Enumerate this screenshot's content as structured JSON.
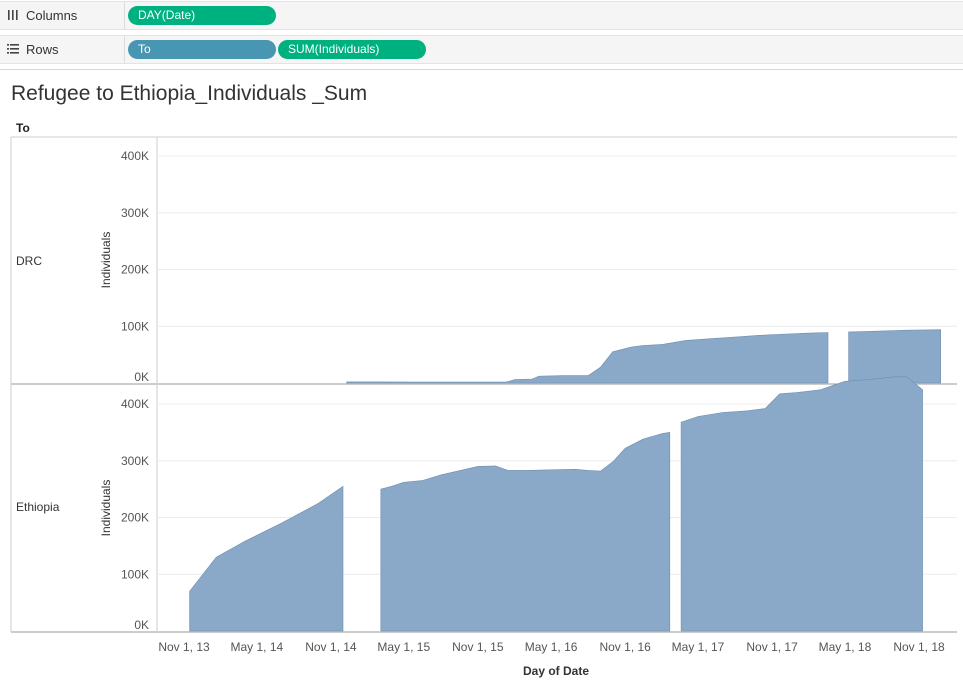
{
  "columns_shelf": {
    "label": "Columns",
    "pills": [
      {
        "text": "DAY(Date)",
        "color": "#00b180"
      }
    ]
  },
  "rows_shelf": {
    "label": "Rows",
    "pills": [
      {
        "text": "To",
        "color": "#4996b2"
      },
      {
        "text": "SUM(Individuals)",
        "color": "#00b180"
      }
    ]
  },
  "colors": {
    "area": "#8aa8c7",
    "area_stroke": "#6f8fb2",
    "grid": "#ececec",
    "axis": "#cfcfcf"
  },
  "chart_data": {
    "type": "area",
    "title": "Refugee to Ethiopia_Individuals _Sum",
    "row_dimension": "To",
    "xlabel": "Day of Date",
    "ylabel": "Individuals",
    "x_ticks": [
      "Nov 1, 13",
      "May 1, 14",
      "Nov 1, 14",
      "May 1, 15",
      "Nov 1, 15",
      "May 1, 16",
      "Nov 1, 16",
      "May 1, 17",
      "Nov 1, 17",
      "May 1, 18",
      "Nov 1, 18"
    ],
    "y_ticks": [
      "0K",
      "100K",
      "200K",
      "300K",
      "400K"
    ],
    "ylim": [
      0,
      460000
    ],
    "grid": true,
    "panes": [
      {
        "name": "DRC",
        "segments": [
          [
            [
              "2014-12-10",
              2000
            ],
            [
              "2015-03-01",
              2000
            ],
            [
              "2015-06-01",
              1800
            ],
            [
              "2015-09-01",
              1500
            ],
            [
              "2015-12-01",
              1500
            ],
            [
              "2016-01-10",
              1500
            ],
            [
              "2016-02-01",
              6000
            ],
            [
              "2016-03-15",
              7000
            ],
            [
              "2016-04-01",
              12000
            ],
            [
              "2016-06-01",
              13000
            ],
            [
              "2016-08-01",
              13000
            ],
            [
              "2016-09-01",
              28000
            ],
            [
              "2016-10-01",
              55000
            ],
            [
              "2016-11-15",
              63000
            ],
            [
              "2016-12-15",
              66000
            ],
            [
              "2017-02-01",
              68000
            ],
            [
              "2017-04-01",
              75000
            ],
            [
              "2017-06-01",
              78000
            ],
            [
              "2017-08-01",
              81000
            ],
            [
              "2017-10-01",
              84000
            ],
            [
              "2017-12-01",
              86000
            ],
            [
              "2018-02-01",
              88000
            ],
            [
              "2018-03-20",
              89000
            ]
          ],
          [
            [
              "2018-05-10",
              90000
            ],
            [
              "2018-07-01",
              91000
            ],
            [
              "2018-10-01",
              93000
            ],
            [
              "2018-12-25",
              94000
            ]
          ]
        ]
      },
      {
        "name": "Ethiopia",
        "segments": [
          [
            [
              "2013-11-15",
              70000
            ],
            [
              "2014-01-20",
              130000
            ],
            [
              "2014-04-01",
              158000
            ],
            [
              "2014-07-01",
              190000
            ],
            [
              "2014-10-01",
              225000
            ],
            [
              "2014-12-01",
              255000
            ]
          ],
          [
            [
              "2015-03-05",
              250000
            ],
            [
              "2015-04-01",
              255000
            ],
            [
              "2015-05-01",
              262000
            ],
            [
              "2015-06-15",
              265000
            ],
            [
              "2015-08-01",
              275000
            ],
            [
              "2015-09-01",
              280000
            ],
            [
              "2015-11-01",
              290000
            ],
            [
              "2015-12-15",
              291000
            ],
            [
              "2016-01-15",
              283000
            ],
            [
              "2016-03-01",
              283000
            ],
            [
              "2016-05-01",
              284000
            ],
            [
              "2016-07-01",
              285000
            ],
            [
              "2016-08-01",
              283000
            ],
            [
              "2016-09-01",
              282000
            ],
            [
              "2016-10-01",
              298000
            ],
            [
              "2016-11-01",
              322000
            ],
            [
              "2016-12-15",
              338000
            ],
            [
              "2017-02-01",
              348000
            ],
            [
              "2017-02-20",
              350000
            ]
          ],
          [
            [
              "2017-03-20",
              368000
            ],
            [
              "2017-05-01",
              378000
            ],
            [
              "2017-07-01",
              385000
            ],
            [
              "2017-09-01",
              388000
            ],
            [
              "2017-10-15",
              392000
            ],
            [
              "2017-11-20",
              418000
            ],
            [
              "2018-01-01",
              420000
            ],
            [
              "2018-03-01",
              425000
            ],
            [
              "2018-05-01",
              440000
            ],
            [
              "2018-07-01",
              443000
            ],
            [
              "2018-09-01",
              448000
            ],
            [
              "2018-10-01",
              448000
            ],
            [
              "2018-11-10",
              425000
            ]
          ]
        ]
      }
    ]
  }
}
